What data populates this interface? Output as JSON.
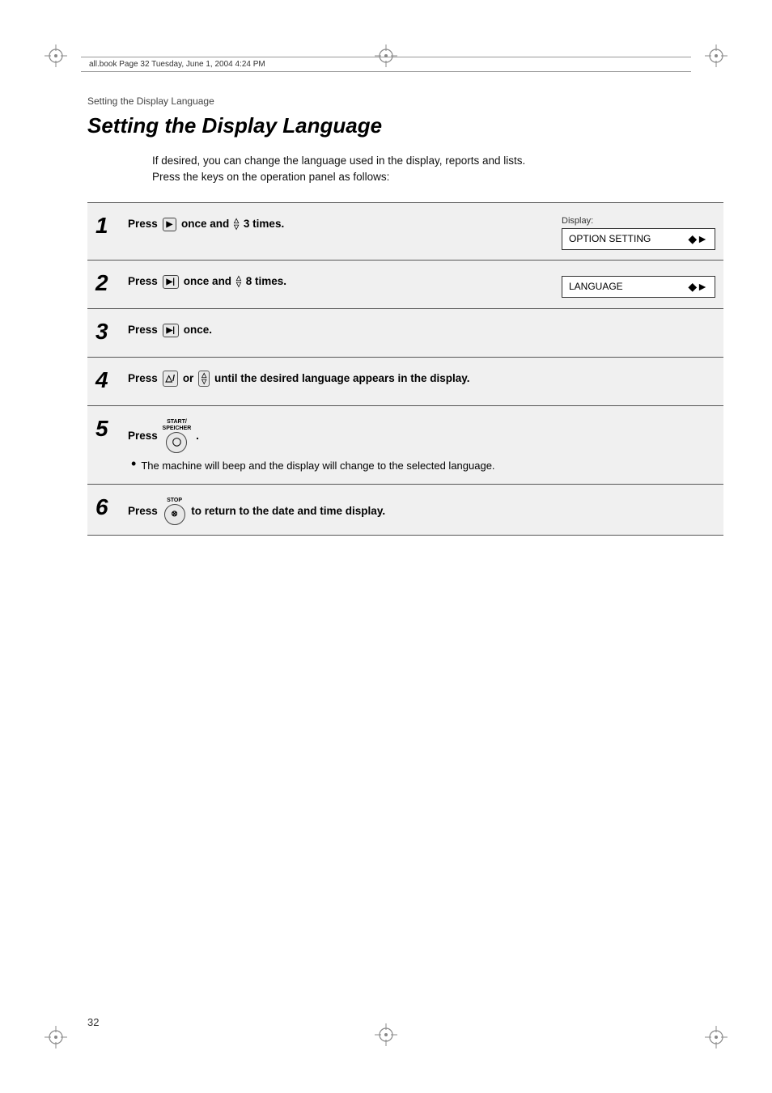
{
  "page": {
    "number": "32",
    "file_info": "all.book   Page 32   Tuesday, June 1, 2004   4:24 PM"
  },
  "breadcrumb": "Setting the Display Language",
  "title": "Setting the Display Language",
  "intro": "If desired, you can change the language used in the display, reports and lists.\nPress the keys on the operation panel as follows:",
  "steps": [
    {
      "number": "1",
      "instruction": "Press ▶ once and △ 3 times.",
      "has_display": true,
      "display_label": "Display:",
      "display_text": "OPTION SETTING",
      "display_arrow": "◆▶"
    },
    {
      "number": "2",
      "instruction": "Press ▶| once and △▽ 8 times.",
      "has_display": true,
      "display_label": "",
      "display_text": "LANGUAGE",
      "display_arrow": "◆▶"
    },
    {
      "number": "3",
      "instruction": "Press ▶| once.",
      "has_display": false
    },
    {
      "number": "4",
      "instruction": "Press △/ or △▽ until the desired language appears in the display.",
      "has_display": false
    },
    {
      "number": "5",
      "instruction": "Press ⊙ .",
      "has_display": false,
      "bullet": "The machine will beep and the display will change to the selected language."
    },
    {
      "number": "6",
      "instruction": "Press ⊙ to return to the date and time display.",
      "has_display": false
    }
  ],
  "labels": {
    "start_speicher": "START/\nSPEICHER",
    "stop": "STOP"
  }
}
